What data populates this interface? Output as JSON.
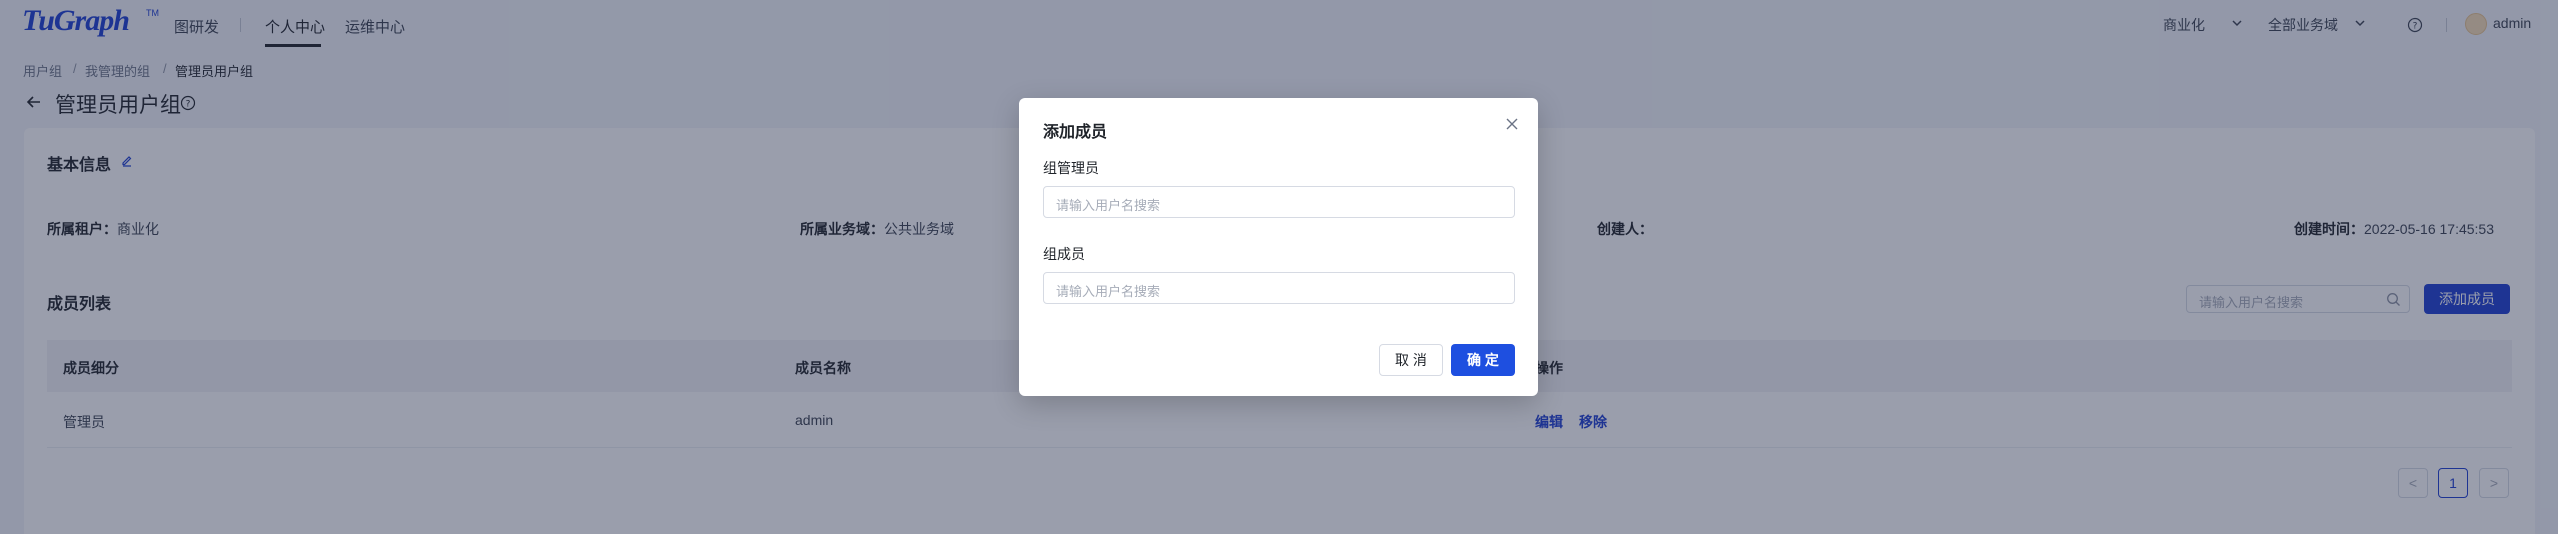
{
  "header": {
    "logo": "TuGraph",
    "logo_tm": "TM",
    "nav": [
      "图研发",
      "个人中心",
      "运维中心"
    ],
    "tenant": "商业化",
    "domain": "全部业务域",
    "user": "admin"
  },
  "breadcrumb": [
    "用户组",
    "我管理的组",
    "管理员用户组"
  ],
  "breadcrumb_sep": "/",
  "page_title": "管理员用户组",
  "basic_info": {
    "title": "基本信息",
    "tenant_label": "所属租户：",
    "tenant_value": "商业化",
    "domain_label": "所属业务域：",
    "domain_value": "公共业务域",
    "creator_label": "创建人：",
    "created_label": "创建时间：",
    "created_value": "2022-05-16 17:45:53"
  },
  "members": {
    "title": "成员列表",
    "search_placeholder": "请输入用户名搜索",
    "add_button": "添加成员",
    "columns": [
      "成员细分",
      "成员名称",
      "操作"
    ],
    "rows": [
      {
        "role": "管理员",
        "name": "admin",
        "actions": [
          "编辑",
          "移除"
        ]
      }
    ]
  },
  "pagination": {
    "prev": "<",
    "current": "1",
    "next": ">"
  },
  "modal": {
    "title": "添加成员",
    "admin_label": "组管理员",
    "admin_placeholder": "请输入用户名搜索",
    "member_label": "组成员",
    "member_placeholder": "请输入用户名搜索",
    "cancel": "取 消",
    "ok": "确 定"
  },
  "colors": {
    "primary": "#1e3fd1",
    "mask": "rgba(31,40,70,0.45)"
  }
}
